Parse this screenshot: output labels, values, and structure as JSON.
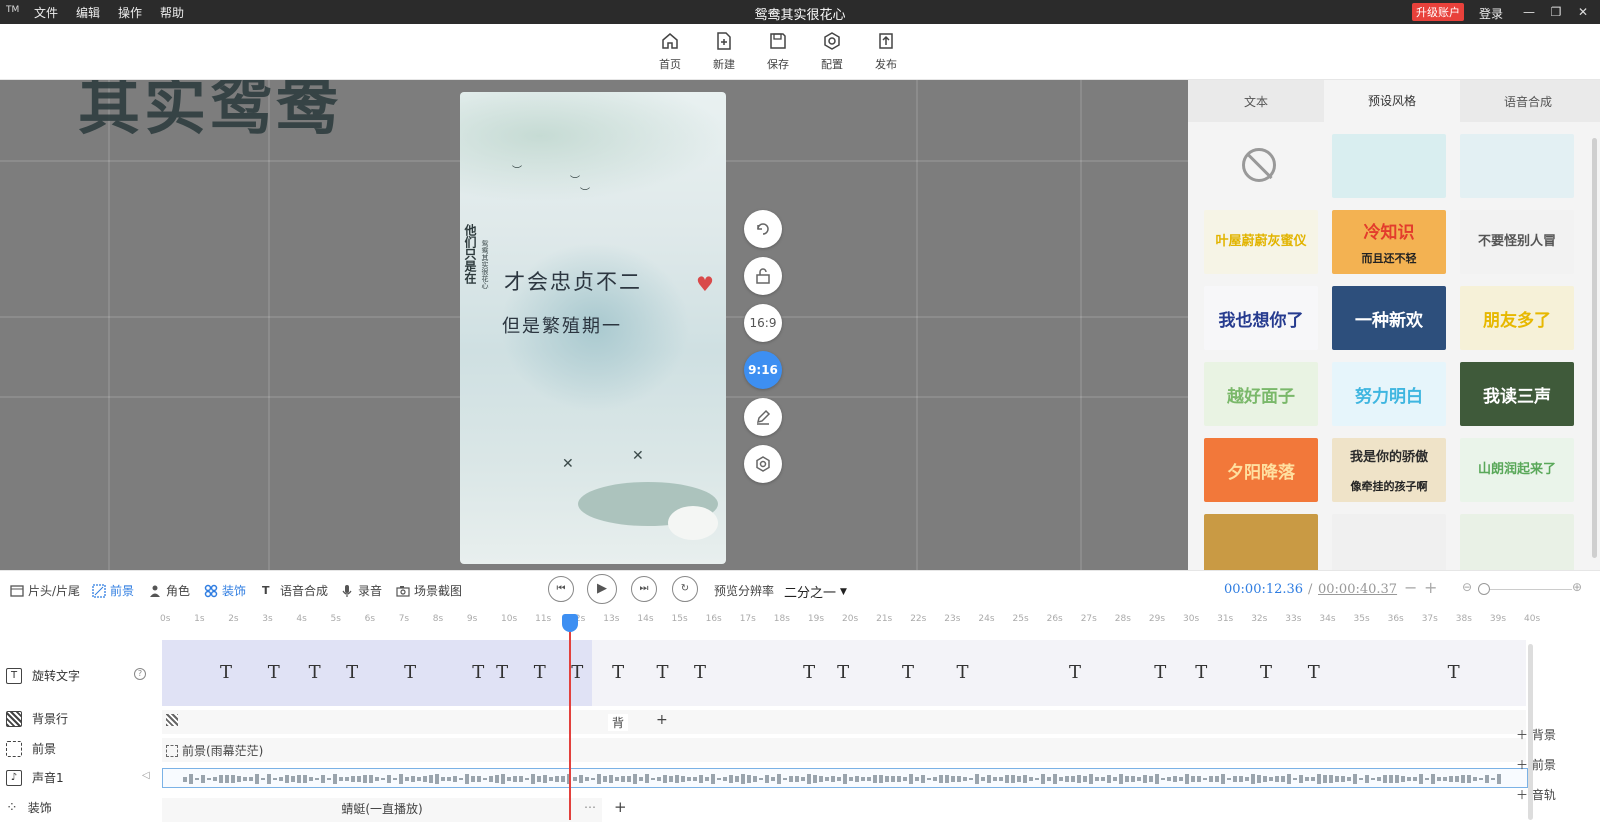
{
  "app": {
    "logo": "TM",
    "menu": [
      "文件",
      "编辑",
      "操作",
      "帮助"
    ],
    "title": "鸳鸯其实很花心",
    "upgrade_label": "升级账户",
    "login_label": "登录"
  },
  "toolbar": [
    {
      "label": "首页",
      "icon": "home-icon"
    },
    {
      "label": "新建",
      "icon": "new-file-icon"
    },
    {
      "label": "保存",
      "icon": "save-icon"
    },
    {
      "label": "配置",
      "icon": "settings-icon"
    },
    {
      "label": "发布",
      "icon": "publish-icon"
    }
  ],
  "canvas": {
    "background_title": "其实鸳鸯",
    "poster": {
      "vertical_text": "他们只是在",
      "vertical_small": "鸳鸯其实很花心",
      "line1": "才会忠贞不二",
      "line2": "但是繁殖期一"
    },
    "side_controls": [
      {
        "icon": "rotate-icon",
        "label": ""
      },
      {
        "icon": "unlock-icon",
        "label": ""
      },
      {
        "icon": "",
        "label": "16:9"
      },
      {
        "icon": "",
        "label": "9:16"
      },
      {
        "icon": "edit-icon",
        "label": ""
      },
      {
        "icon": "target-icon",
        "label": ""
      }
    ],
    "active_ratio": "9:16"
  },
  "right_panel": {
    "tabs": [
      "文本",
      "预设风格",
      "语音合成"
    ],
    "active_tab": "预设风格",
    "styles": [
      {
        "text": "",
        "bg": "#f4f4f4",
        "color": "#999"
      },
      {
        "text": "",
        "bg": "#d9eef0",
        "color": "#333"
      },
      {
        "text": "",
        "bg": "#e3f0f3",
        "color": "#333"
      },
      {
        "text": "叶屋蔚蔚灰蜜仪",
        "bg": "#f6f4e6",
        "color": "#e2b400"
      },
      {
        "text": "冷知识",
        "sub": "而且还不轻",
        "bg": "#f3b252",
        "color": "#e33c2c"
      },
      {
        "text": "不要怪别人冒",
        "bg": "#f2f2f2",
        "color": "#555"
      },
      {
        "text": "我也想你了",
        "bg": "#f7f7f9",
        "color": "#263b8f"
      },
      {
        "text": "一种新欢",
        "bg": "#2d4f7c",
        "color": "#ffffff"
      },
      {
        "text": "朋友多了",
        "bg": "#f6f1d8",
        "color": "#e7b800"
      },
      {
        "text": "越好面子",
        "bg": "#e9f3e3",
        "color": "#7ab86a"
      },
      {
        "text": "努力明白",
        "bg": "#e6f5fb",
        "color": "#3fb6e0"
      },
      {
        "text": "我读三声",
        "bg": "#3f5a3a",
        "color": "#ffffff"
      },
      {
        "text": "夕阳降落",
        "bg": "#f2783a",
        "color": "#ffe0a0"
      },
      {
        "text": "我是你的骄傲",
        "sub": "像牵挂的孩子啊",
        "bg": "#efe3c8",
        "color": "#2b2b2b"
      },
      {
        "text": "山朗润起来了",
        "bg": "#eaf4ea",
        "color": "#5aa85a"
      },
      {
        "text": "",
        "bg": "#c99a44",
        "color": "#fff"
      },
      {
        "text": "",
        "bg": "#f0f0f0",
        "color": "#555"
      },
      {
        "text": "",
        "bg": "#e9f1e6",
        "color": "#555"
      }
    ]
  },
  "timeline_controls": {
    "left_items": [
      {
        "label": "片头/片尾",
        "icon": "film-icon",
        "active": false
      },
      {
        "label": "前景",
        "icon": "foreground-icon",
        "active": true
      },
      {
        "label": "角色",
        "icon": "person-icon",
        "active": false
      },
      {
        "label": "装饰",
        "icon": "decoration-icon",
        "active": true
      },
      {
        "label": "语音合成",
        "icon": "tts-icon",
        "active": false
      },
      {
        "label": "录音",
        "icon": "mic-icon",
        "active": false
      },
      {
        "label": "场景截图",
        "icon": "camera-icon",
        "active": false
      }
    ],
    "preview_res_label": "预览分辨率",
    "preview_res_value": "二分之一",
    "current_time": "00:00:12.36",
    "separator": "/",
    "total_time": "00:00:40.37"
  },
  "ruler_ticks": [
    "0s",
    "1s",
    "2s",
    "3s",
    "4s",
    "5s",
    "6s",
    "7s",
    "8s",
    "9s",
    "10s",
    "11s",
    "12s",
    "13s",
    "14s",
    "15s",
    "16s",
    "17s",
    "18s",
    "19s",
    "20s",
    "21s",
    "22s",
    "23s",
    "24s",
    "25s",
    "26s",
    "27s",
    "28s",
    "29s",
    "30s",
    "31s",
    "32s",
    "33s",
    "34s",
    "35s",
    "36s",
    "37s",
    "38s",
    "39s",
    "40s"
  ],
  "tracks": {
    "labels": [
      "旋转文字",
      "背景行",
      "前景",
      "声音1",
      "装饰"
    ],
    "text_track_mark": "T",
    "text_marks_seconds": [
      1.7,
      3.1,
      4.3,
      5.4,
      7.1,
      9.1,
      9.8,
      10.9,
      12.0,
      13.2,
      14.5,
      15.6,
      18.8,
      19.8,
      21.7,
      23.3,
      26.6,
      29.1,
      30.3,
      32.2,
      33.6,
      37.7
    ],
    "background_clip": "背",
    "foreground_clip": "前景(雨幕茫茫)",
    "decoration_clip": "蜻蜓(一直播放)",
    "add_buttons": [
      "背景",
      "前景",
      "音轨"
    ]
  }
}
